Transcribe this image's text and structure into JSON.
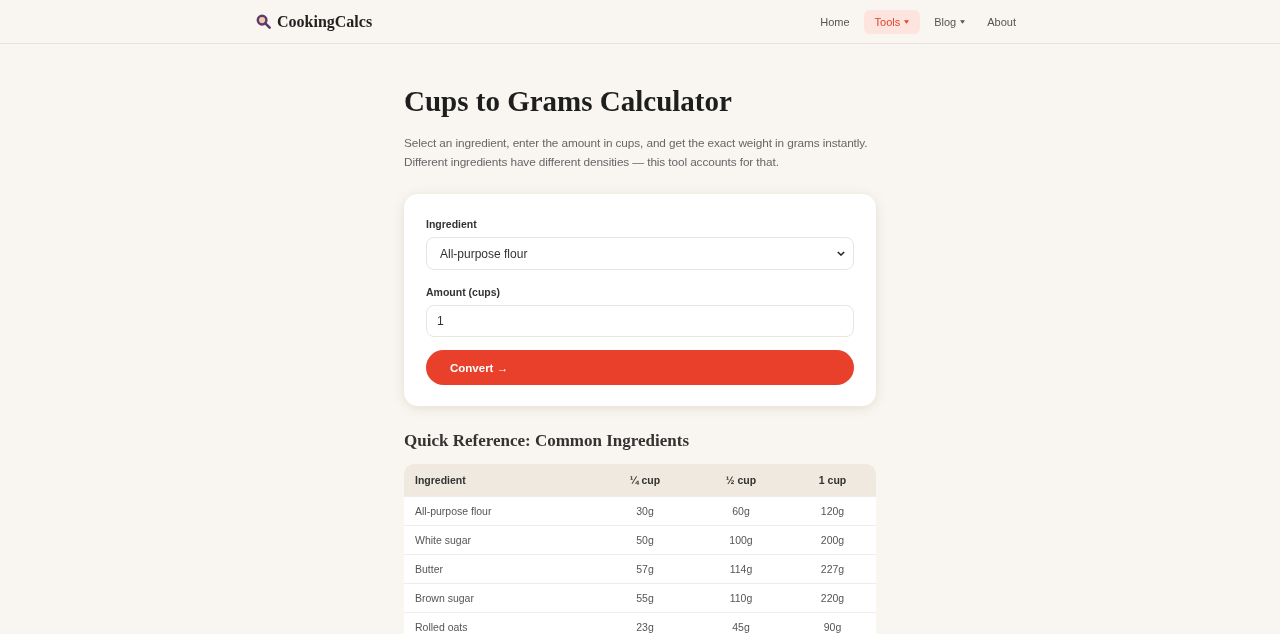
{
  "header": {
    "logo": "CookingCalcs",
    "nav": [
      {
        "label": "Home",
        "selected": false,
        "dropdown": false
      },
      {
        "label": "Tools",
        "selected": true,
        "dropdown": true
      },
      {
        "label": "Blog",
        "selected": false,
        "dropdown": true
      },
      {
        "label": "About",
        "selected": false,
        "dropdown": false
      }
    ]
  },
  "page": {
    "title": "Cups to Grams Calculator",
    "intro": "Select an ingredient, enter the amount in cups, and get the exact weight in grams instantly. Different ingredients have different densities — this tool accounts for that."
  },
  "form": {
    "fields": [
      {
        "kind": "select",
        "label": "Ingredient",
        "value": "All-purpose flour"
      },
      {
        "kind": "input",
        "label": "Amount (cups)",
        "value": "1"
      }
    ],
    "button": "Convert →"
  },
  "reference": {
    "title": "Quick Reference: Common Ingredients",
    "columns": [
      "Ingredient",
      "¼ cup",
      "½ cup",
      "1 cup"
    ],
    "rows": [
      [
        "All-purpose flour",
        "30g",
        "60g",
        "120g"
      ],
      [
        "White sugar",
        "50g",
        "100g",
        "200g"
      ],
      [
        "Butter",
        "57g",
        "114g",
        "227g"
      ],
      [
        "Brown sugar",
        "55g",
        "110g",
        "220g"
      ],
      [
        "Rolled oats",
        "23g",
        "45g",
        "90g"
      ]
    ]
  }
}
